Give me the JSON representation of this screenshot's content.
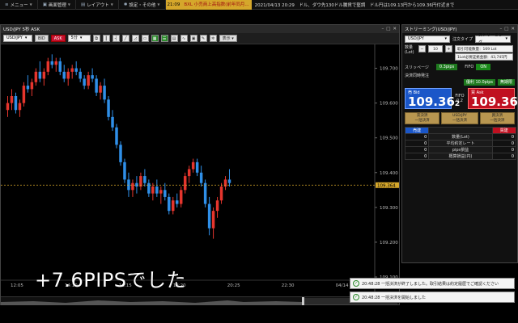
{
  "menubar": {
    "items": [
      {
        "label": "メニュー",
        "glyph": "≡"
      },
      {
        "label": "画面管理",
        "glyph": "▣"
      },
      {
        "label": "レイアウト",
        "glyph": "▤"
      },
      {
        "label": "設定・その他",
        "glyph": "✱"
      }
    ],
    "ticker": {
      "time": "21:09",
      "headline_prefix": "BXL",
      "headline": "小売商上高指数(前年同月...",
      "news": "2021/04/13 20:29　ドル、ダウ先130ドル騰貨で堅調　ドル円は109.13円から109.36円付近まで"
    }
  },
  "chart_panel": {
    "title": "USD/JPY 5秒 ASK",
    "toolbar": {
      "pair": "USD/JPY",
      "bid_label": "BID",
      "ask_label": "ASK",
      "interval": "5分",
      "view_label": "表示"
    },
    "overlay_text": "+7.6PIPSでした",
    "current_price_label": "109.364"
  },
  "chart_data": {
    "type": "candlestick",
    "pair": "USD/JPY",
    "ylim": [
      109.1,
      109.75
    ],
    "y_ticks": [
      "109.700",
      "109.600",
      "109.500",
      "109.400",
      "109.300",
      "109.200",
      "109.100"
    ],
    "y_tick_values": [
      109.7,
      109.6,
      109.5,
      109.4,
      109.3,
      109.2,
      109.1
    ],
    "x_ticks": [
      "12:05",
      "14:10",
      "16:15",
      "18:20",
      "20:25",
      "22:30",
      "04/14 00:35"
    ],
    "reference_line": 109.364,
    "candles": [
      [
        109.58,
        109.62,
        109.56,
        109.6
      ],
      [
        109.6,
        109.64,
        109.58,
        109.62
      ],
      [
        109.62,
        109.63,
        109.57,
        109.58
      ],
      [
        109.58,
        109.61,
        109.56,
        109.6
      ],
      [
        109.6,
        109.66,
        109.59,
        109.65
      ],
      [
        109.65,
        109.68,
        109.63,
        109.64
      ],
      [
        109.64,
        109.67,
        109.62,
        109.66
      ],
      [
        109.66,
        109.7,
        109.65,
        109.69
      ],
      [
        109.69,
        109.72,
        109.66,
        109.67
      ],
      [
        109.67,
        109.7,
        109.65,
        109.69
      ],
      [
        109.69,
        109.73,
        109.68,
        109.72
      ],
      [
        109.72,
        109.74,
        109.7,
        109.71
      ],
      [
        109.71,
        109.73,
        109.69,
        109.72
      ],
      [
        109.72,
        109.73,
        109.68,
        109.69
      ],
      [
        109.69,
        109.71,
        109.66,
        109.67
      ],
      [
        109.67,
        109.7,
        109.65,
        109.69
      ],
      [
        109.69,
        109.71,
        109.67,
        109.7
      ],
      [
        109.7,
        109.72,
        109.68,
        109.69
      ],
      [
        109.69,
        109.7,
        109.66,
        109.67
      ],
      [
        109.67,
        109.68,
        109.64,
        109.65
      ],
      [
        109.65,
        109.69,
        109.64,
        109.68
      ],
      [
        109.68,
        109.7,
        109.66,
        109.67
      ],
      [
        109.67,
        109.68,
        109.62,
        109.63
      ],
      [
        109.63,
        109.66,
        109.61,
        109.65
      ],
      [
        109.65,
        109.67,
        109.6,
        109.61
      ],
      [
        109.61,
        109.62,
        109.55,
        109.56
      ],
      [
        109.56,
        109.58,
        109.52,
        109.53
      ],
      [
        109.53,
        109.54,
        109.47,
        109.48
      ],
      [
        109.48,
        109.49,
        109.42,
        109.43
      ],
      [
        109.43,
        109.44,
        109.37,
        109.38
      ],
      [
        109.38,
        109.4,
        109.33,
        109.35
      ],
      [
        109.35,
        109.38,
        109.33,
        109.37
      ],
      [
        109.37,
        109.39,
        109.34,
        109.36
      ],
      [
        109.36,
        109.4,
        109.35,
        109.39
      ],
      [
        109.39,
        109.41,
        109.36,
        109.37
      ],
      [
        109.37,
        109.38,
        109.33,
        109.34
      ],
      [
        109.34,
        109.37,
        109.32,
        109.36
      ],
      [
        109.36,
        109.38,
        109.33,
        109.34
      ],
      [
        109.34,
        109.36,
        109.31,
        109.35
      ],
      [
        109.35,
        109.37,
        109.32,
        109.33
      ],
      [
        109.33,
        109.34,
        109.28,
        109.29
      ],
      [
        109.29,
        109.33,
        109.28,
        109.32
      ],
      [
        109.32,
        109.34,
        109.3,
        109.31
      ],
      [
        109.31,
        109.36,
        109.3,
        109.35
      ],
      [
        109.35,
        109.4,
        109.34,
        109.39
      ],
      [
        109.39,
        109.42,
        109.37,
        109.41
      ],
      [
        109.41,
        109.44,
        109.4,
        109.43
      ],
      [
        109.43,
        109.44,
        109.39,
        109.4
      ],
      [
        109.4,
        109.42,
        109.36,
        109.37
      ],
      [
        109.37,
        109.38,
        109.3,
        109.31
      ],
      [
        109.31,
        109.33,
        109.22,
        109.24
      ],
      [
        109.24,
        109.3,
        109.21,
        109.29
      ],
      [
        109.29,
        109.33,
        109.27,
        109.32
      ],
      [
        109.32,
        109.37,
        109.31,
        109.36
      ],
      [
        109.36,
        109.39,
        109.35,
        109.38
      ],
      [
        109.38,
        109.41,
        109.36,
        109.37
      ]
    ]
  },
  "stream_panel": {
    "title": "ストリーミング(USD/JPY)",
    "pair": "USD/JPY",
    "order_type_label": "注文タイプ",
    "order_type": "ストリーミング",
    "qty_label": "数量(Lot)",
    "qty": "10",
    "tradable_label": "取引可能数量：169 Lot",
    "margin_label": "1Lot必要証拠金額：43,745円",
    "slippage_label": "スリッページ",
    "slippage": "0.3pips",
    "fifo_label": "FIFO",
    "fifo_value": "ON",
    "settle_label": "決済同時発注",
    "spread_label": "優利 10.0pips",
    "unlimited_label": "無期限",
    "bid_label": "売 Bid",
    "bid_price_main": "109.36",
    "bid_price_pip": "2",
    "fifo_mid": "FIFO",
    "spread_mid": "0.2",
    "ask_label": "買 Ask",
    "ask_price_main": "109.36",
    "ask_price_pip": "4",
    "settle_sell": "売決済\n一括決済",
    "settle_pair": "USD/JPY\n一括決済",
    "settle_buy": "買決済\n一括決済",
    "positions": {
      "sell_header": "売建",
      "buy_header": "買建",
      "rows": [
        {
          "sell": "0",
          "label": "数量(Lot)",
          "buy": "0"
        },
        {
          "sell": "0",
          "label": "平均約定レート",
          "buy": "0"
        },
        {
          "sell": "0",
          "label": "pips損益",
          "buy": "0"
        },
        {
          "sell": "0",
          "label": "概算損益(円)",
          "buy": "0"
        }
      ]
    }
  },
  "notifications": [
    {
      "text": "20:48:28 一括決済が終了しました。取引結果は約定履歴でご確認ください"
    },
    {
      "text": "20:48:28 一括決済を開始しました"
    }
  ],
  "colors": {
    "up_candle": "#e5352d",
    "down_candle": "#2f8fe8",
    "reference_line": "#d5a72b",
    "bid": "#1a56c8",
    "ask": "#c01020"
  }
}
